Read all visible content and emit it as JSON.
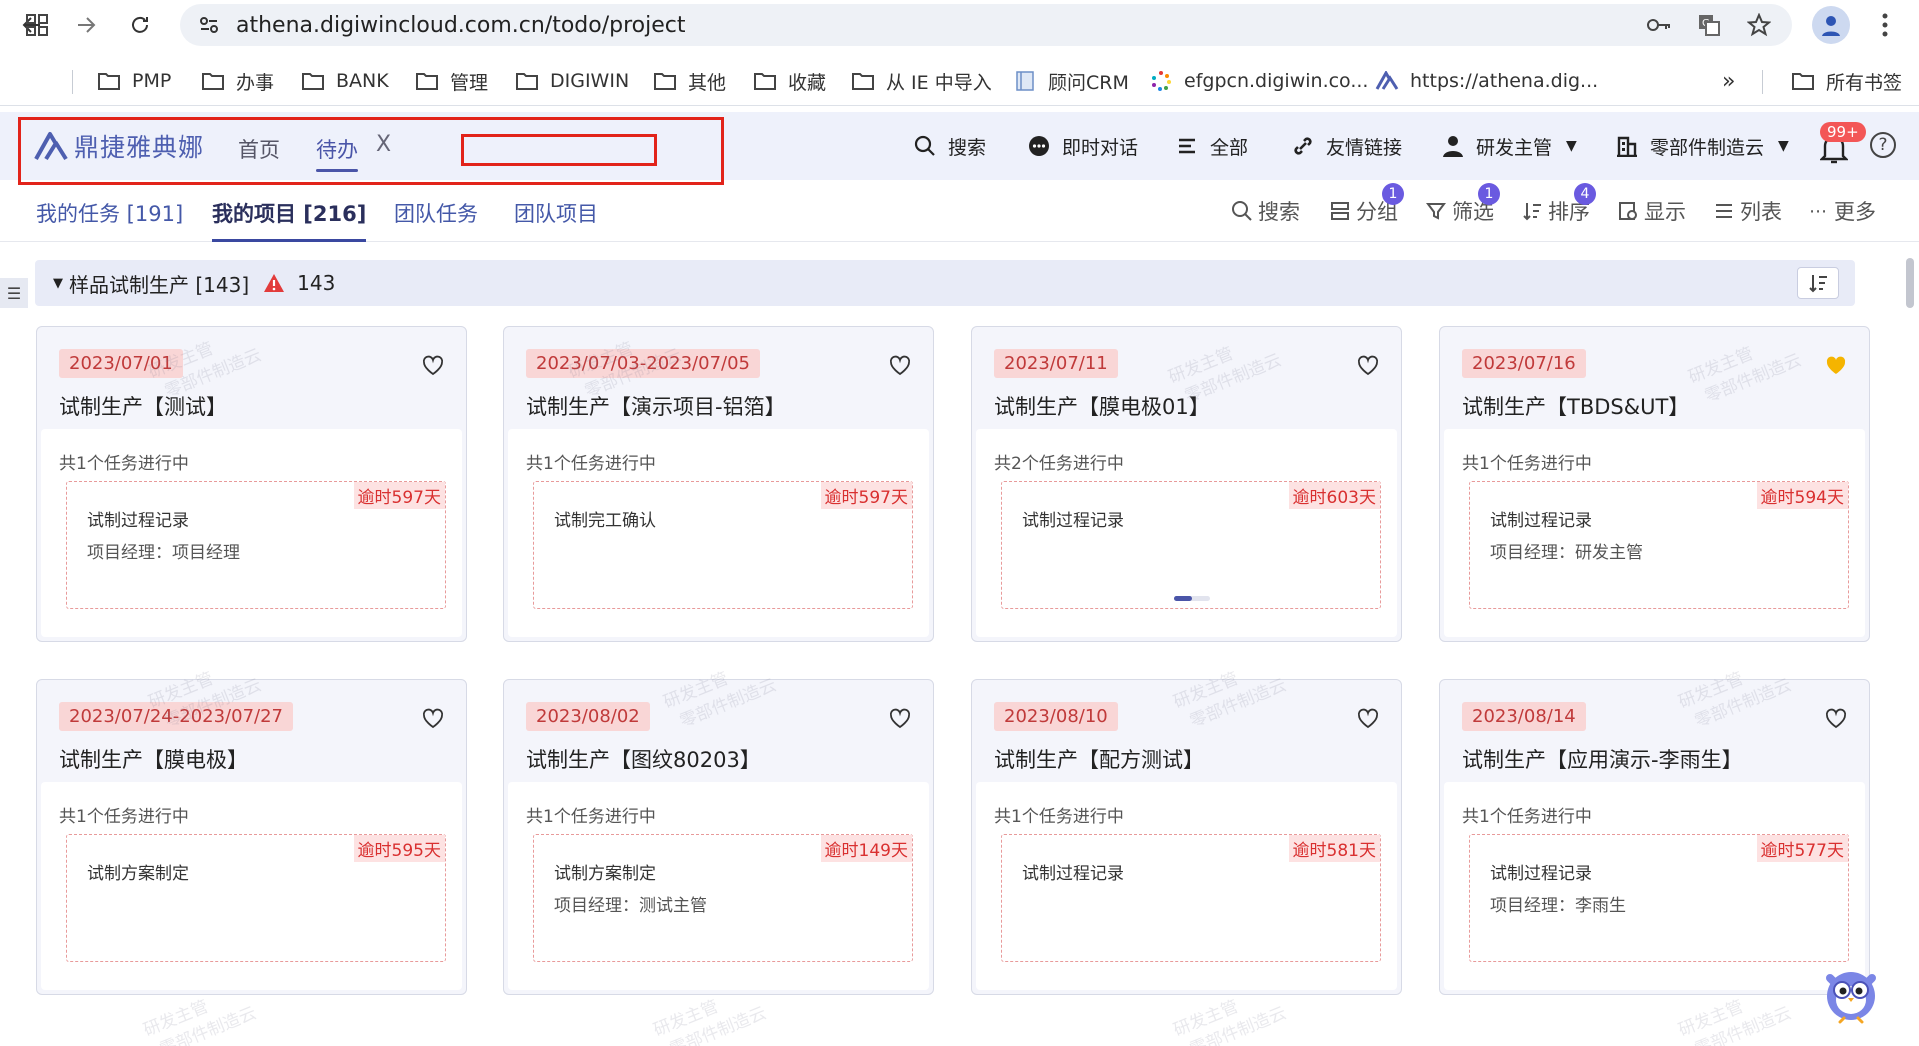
{
  "browser": {
    "url": "athena.digiwincloud.com.cn/todo/project",
    "bookmarks": [
      {
        "label": "PMP",
        "icon": "folder-icon"
      },
      {
        "label": "办事",
        "icon": "folder-icon"
      },
      {
        "label": "BANK",
        "icon": "folder-icon"
      },
      {
        "label": "管理",
        "icon": "folder-icon"
      },
      {
        "label": "DIGIWIN",
        "icon": "folder-icon"
      },
      {
        "label": "其他",
        "icon": "folder-icon"
      },
      {
        "label": "收藏",
        "icon": "folder-icon"
      },
      {
        "label": "从 IE 中导入",
        "icon": "folder-icon"
      },
      {
        "label": "顾问CRM",
        "icon": "page-icon"
      },
      {
        "label": "efgpcn.digiwin.co...",
        "icon": "spinner-icon"
      },
      {
        "label": "https://athena.dig...",
        "icon": "athena-icon"
      }
    ],
    "more_bookmarks": "»",
    "all_bookmarks": "所有书签"
  },
  "app": {
    "brand": "鼎捷雅典娜",
    "nav": {
      "home": "首页",
      "todo": "待办",
      "close": "X"
    },
    "tools": {
      "search": "搜索",
      "chat": "即时对话",
      "all": "全部",
      "links": "友情链接",
      "role": "研发主管",
      "tenant": "零部件制造云"
    },
    "notification_badge": "99+",
    "help": "?"
  },
  "subtabs": [
    "我的任务 [191]",
    "我的项目 [216]",
    "团队任务",
    "团队项目"
  ],
  "toolbar": {
    "search": "搜索",
    "group": "分组",
    "group_badge": "1",
    "filter": "筛选",
    "filter_badge": "1",
    "sort": "排序",
    "sort_badge": "4",
    "display": "显示",
    "list": "列表",
    "more": "更多"
  },
  "group": {
    "title": "样品试制生产 [143]",
    "warning_count": "143"
  },
  "cards": [
    {
      "date": "2023/07/01",
      "title": "试制生产【测试】",
      "progress": "共1个任务进行中",
      "overdue": "逾时597天",
      "task": "试制过程记录",
      "manager": "项目经理：项目经理",
      "favorite": false
    },
    {
      "date": "2023/07/03-2023/07/05",
      "title": "试制生产【演示项目-铝箔】",
      "progress": "共1个任务进行中",
      "overdue": "逾时597天",
      "task": "试制完工确认",
      "manager": "",
      "favorite": false
    },
    {
      "date": "2023/07/11",
      "title": "试制生产【膜电极01】",
      "progress": "共2个任务进行中",
      "overdue": "逾时603天",
      "task": "试制过程记录",
      "manager": "",
      "favorite": false
    },
    {
      "date": "2023/07/16",
      "title": "试制生产【TBDS&UT】",
      "progress": "共1个任务进行中",
      "overdue": "逾时594天",
      "task": "试制过程记录",
      "manager": "项目经理：研发主管",
      "favorite": true
    },
    {
      "date": "2023/07/24-2023/07/27",
      "title": "试制生产【膜电极】",
      "progress": "共1个任务进行中",
      "overdue": "逾时595天",
      "task": "试制方案制定",
      "manager": "",
      "favorite": false
    },
    {
      "date": "2023/08/02",
      "title": "试制生产【图纹80203】",
      "progress": "共1个任务进行中",
      "overdue": "逾时149天",
      "task": "试制方案制定",
      "manager": "项目经理：测试主管",
      "favorite": false
    },
    {
      "date": "2023/08/10",
      "title": "试制生产【配方测试】",
      "progress": "共1个任务进行中",
      "overdue": "逾时581天",
      "task": "试制过程记录",
      "manager": "",
      "favorite": false
    },
    {
      "date": "2023/08/14",
      "title": "试制生产【应用演示-李雨生】",
      "progress": "共1个任务进行中",
      "overdue": "逾时577天",
      "task": "试制过程记录",
      "manager": "项目经理：李雨生",
      "favorite": false
    }
  ],
  "watermark": {
    "line1": "研发主管",
    "line2": "零部件制造云"
  },
  "colors": {
    "brand": "#4a55a8",
    "overdue": "#d93030",
    "highlight": "#e2231a",
    "favorite": "#f5b400"
  }
}
